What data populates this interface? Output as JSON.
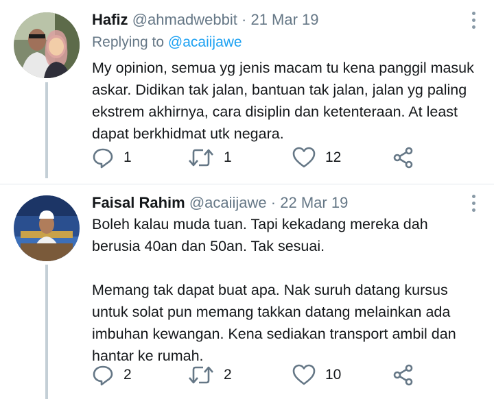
{
  "tweets": [
    {
      "name": "Hafiz",
      "handle": "@ahmadwebbit",
      "separator": "·",
      "date": "21 Mar 19",
      "replying_prefix": "Replying to",
      "replying_handle": "@acaiijawe",
      "text": "My opinion, semua yg jenis macam tu kena panggil masuk\naskar. Didikan tak jalan, bantuan tak jalan, jalan yg paling\nekstrem akhirnya, cara disiplin dan ketenteraan. At least\ndapat berkhidmat utk negara.",
      "replies": "1",
      "retweets": "1",
      "likes": "12"
    },
    {
      "name": "Faisal Rahim",
      "handle": "@acaiijawe",
      "separator": "·",
      "date": "22 Mar 19",
      "text": "Boleh kalau muda tuan. Tapi kekadang mereka dah\nberusia 40an dan 50an. Tak sesuai.\n\nMemang tak dapat buat apa. Nak suruh datang kursus\nuntuk solat pun memang takkan datang melainkan ada\nimbuhan kewangan. Kena sediakan transport ambil dan\nhantar ke rumah.",
      "replies": "2",
      "retweets": "2",
      "likes": "10"
    }
  ],
  "icons": {
    "reply": "reply-icon",
    "retweet": "retweet-icon",
    "like": "heart-icon",
    "share": "share-icon",
    "more": "more-options-icon"
  },
  "colors": {
    "text": "#14171a",
    "muted": "#657786",
    "link": "#1da1f2",
    "thread_line": "#c4cfd6",
    "icon": "#657786"
  }
}
